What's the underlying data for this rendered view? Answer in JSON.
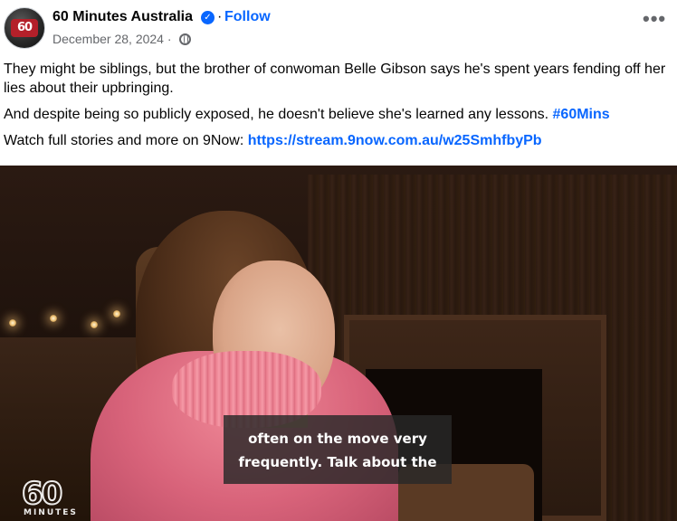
{
  "post": {
    "page_name": "60 Minutes Australia",
    "verified_icon": "verified-badge-icon",
    "separator": "·",
    "follow_label": "Follow",
    "timestamp": "December 28, 2024 ·",
    "audience_icon": "globe-icon",
    "more_icon": "more-options-icon",
    "more_glyph": "•••",
    "avatar_text": "60"
  },
  "content": {
    "paragraph_1": "They might be siblings, but the brother of conwoman Belle Gibson says he's spent years fending off her lies about their upbringing.",
    "paragraph_2_text": "And despite being so publicly exposed, he doesn't believe she's learned any lessons. ",
    "paragraph_2_hashtag": "#60Mins",
    "paragraph_3_text": "Watch full stories and more on 9Now: ",
    "paragraph_3_link": "https://stream.9now.com.au/w25SmhfbyPb"
  },
  "video": {
    "subtitle_line_1": "often on the move very",
    "subtitle_line_2": "frequently. Talk about the",
    "watermark_number": "60",
    "watermark_word": "MINUTES"
  },
  "colors": {
    "link_blue": "#0866ff",
    "text_primary": "#050505",
    "text_secondary": "#65676b",
    "sweater_pink": "#e97a8b"
  }
}
